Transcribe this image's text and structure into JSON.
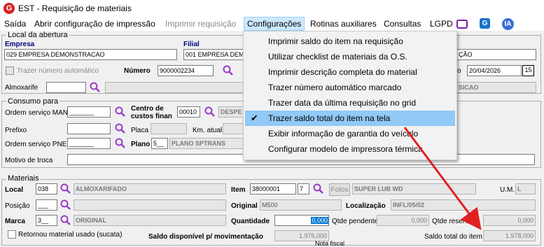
{
  "window": {
    "app_icon": "G",
    "title": "EST - Requisição de materiais"
  },
  "menu": {
    "items": [
      "Saída",
      "Abrir configuração de impressão",
      "Imprimir requisição",
      "Configurações",
      "Rotinas auxiliares",
      "Consultas",
      "LGPD"
    ],
    "icons": [
      "monitor-icon",
      "g-app-icon",
      "ia-icon"
    ],
    "ia_label": "IA",
    "g_label": "G",
    "accent": "#0078d7"
  },
  "dropdown": {
    "items": [
      "Imprimir saldo do item na requisição",
      "Utilizar checklist de materiais da O.S.",
      "Imprimir descrição completa do material",
      "Trazer número automático marcado",
      "Trazer data da última requisição no grid",
      "Trazer saldo total do item na tela",
      "Exibir informação de garantia do veículo",
      "Configurar modelo de impressora térmica"
    ],
    "checked": "✔"
  },
  "abertura": {
    "section_title": "Local da abertura",
    "empresa_label": "Empresa",
    "empresa_value": "029 EMPRESA DEMONSTRACAO",
    "filial_label": "Filial",
    "filial_value": "001 EMPRESA DEM",
    "filial_value_right": "ÇÃO",
    "trazer_numero_label": "Trazer número automático",
    "numero_label": "Número",
    "numero_value": "9000002234",
    "data_label": "o",
    "data_value": "20/04/2026",
    "calendar_value": "15",
    "almoxarife_label": "Almoxarife",
    "almoxarife_right": "SICAO"
  },
  "consumo": {
    "section_title": "Consumo para",
    "os_man_label": "Ordem serviço MAN",
    "os_man_value": "_______",
    "centro_label_1": "Centro de",
    "centro_label_2": "custos finan",
    "centro_code": "00010",
    "centro_desc": "DESPE",
    "prefixo_label": "Prefixo",
    "placa_label": "Placa",
    "km_label": "Km. atual",
    "os_pne_label": "Ordem serviço PNE",
    "os_pne_value": "_______",
    "plano_label": "Plano",
    "plano_code": "5__",
    "plano_desc": "PLANO SPTRANS",
    "motivo_label": "Motivo de troca"
  },
  "materiais": {
    "section_title": "Materiais",
    "local_label": "Local",
    "local_code": "038",
    "local_desc": "ALMOXARIFADO",
    "item_label": "Item",
    "item_code": "38000001",
    "item_digit": "7",
    "fotos_label": "Fotos",
    "item_desc": "SUPER LUB WD",
    "um_label": "U.M.",
    "um_value": "L",
    "posicao_label": "Posição",
    "posicao_value": "___",
    "original_label": "Original",
    "original_value": "M500",
    "localizacao_label": "Localização",
    "localizacao_value": "INFL/05/02",
    "marca_label": "Marca",
    "marca_code": "3__",
    "marca_desc": "ORIGINAL",
    "quantidade_label": "Quantidade",
    "quantidade_value": "0,000",
    "qtde_pendente_label": "Qtde pendente",
    "qtde_pendente_value": "0,000",
    "qtde_reserva_label": "Qtde reserva",
    "qtde_reserva_value": "0,000",
    "retornou_label": "Retornou material usado (sucata)",
    "saldo_disp_label": "Saldo disponível p/ movimentação",
    "saldo_disp_value": "1.976,000",
    "saldo_total_label": "Saldo total do item",
    "saldo_total_value": "1.978,000",
    "bottom_partial": "Nota fiscal"
  },
  "annotation": {
    "arrow_color": "#e02020"
  }
}
